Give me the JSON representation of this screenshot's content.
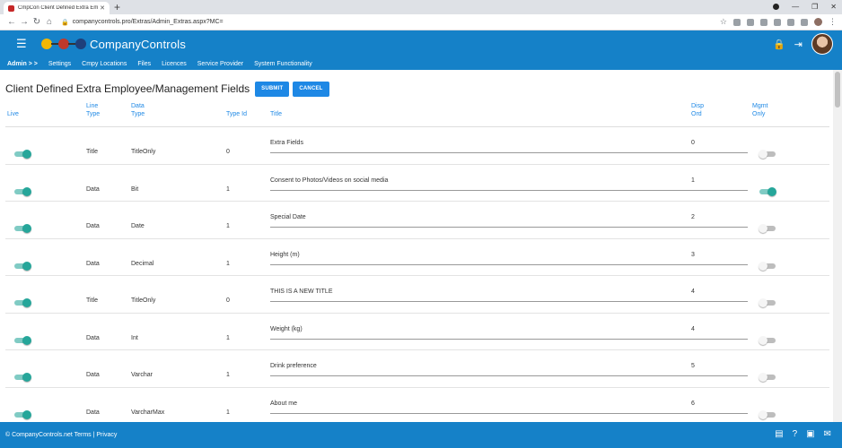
{
  "browser": {
    "tab_title": "CmpCon Client Defined Extra Em",
    "url": "companycontrols.pro/Extras/Admin_Extras.aspx?MC="
  },
  "app": {
    "brand": "CompanyControls"
  },
  "menu": {
    "admin": "Admin > >",
    "items": [
      "Settings",
      "Cmpy Locations",
      "Files",
      "Licences",
      "Service Provider",
      "System Functionality"
    ]
  },
  "page": {
    "title": "Client Defined Extra Employee/Management Fields",
    "submit": "SUBMIT",
    "cancel": "CANCEL"
  },
  "table": {
    "headers": {
      "live": "Live",
      "line_type": "Line Type",
      "data_type": "Data Type",
      "type_id": "Type Id",
      "title": "Title",
      "disp_ord": "Disp Ord",
      "mgmt_only": "Mgmt Only"
    },
    "rows": [
      {
        "live": true,
        "line_type": "Title",
        "data_type": "TitleOnly",
        "type_id": "0",
        "title": "Extra Fields",
        "disp_ord": "0",
        "mgmt": false
      },
      {
        "live": true,
        "line_type": "Data",
        "data_type": "Bit",
        "type_id": "1",
        "title": "Consent to Photos/Videos on social media",
        "disp_ord": "1",
        "mgmt": true
      },
      {
        "live": true,
        "line_type": "Data",
        "data_type": "Date",
        "type_id": "1",
        "title": "Special Date",
        "disp_ord": "2",
        "mgmt": false
      },
      {
        "live": true,
        "line_type": "Data",
        "data_type": "Decimal",
        "type_id": "1",
        "title": "Height (m)",
        "disp_ord": "3",
        "mgmt": false
      },
      {
        "live": true,
        "line_type": "Title",
        "data_type": "TitleOnly",
        "type_id": "0",
        "title": "THIS IS A NEW TITLE",
        "disp_ord": "4",
        "mgmt": false
      },
      {
        "live": true,
        "line_type": "Data",
        "data_type": "Int",
        "type_id": "1",
        "title": "Weight (kg)",
        "disp_ord": "4",
        "mgmt": false
      },
      {
        "live": true,
        "line_type": "Data",
        "data_type": "Varchar",
        "type_id": "1",
        "title": "Drink preference",
        "disp_ord": "5",
        "mgmt": false
      },
      {
        "live": true,
        "line_type": "Data",
        "data_type": "VarcharMax",
        "type_id": "1",
        "title": "About me",
        "disp_ord": "6",
        "mgmt": false
      }
    ]
  },
  "footer": {
    "text": "© CompanyControls.net Terms | Privacy"
  }
}
